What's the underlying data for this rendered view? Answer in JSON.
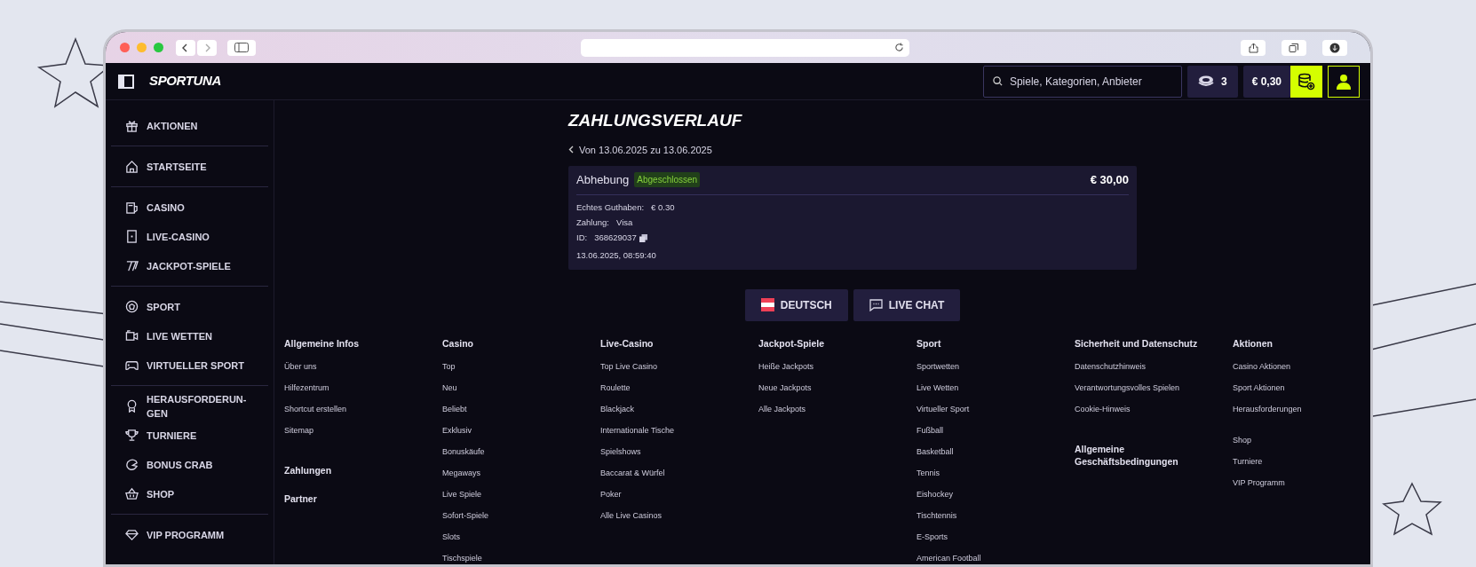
{
  "topbar": {
    "logo": "SPORTUNA",
    "search": {
      "placeholder": "Spiele, Kategorien, Anbieter"
    },
    "coins": "3",
    "balance": "€ 0,30"
  },
  "sidebar": {
    "groups": [
      [
        {
          "label": "AKTIONEN"
        }
      ],
      [
        {
          "label": "STARTSEITE"
        }
      ],
      [
        {
          "label": "CASINO"
        },
        {
          "label": "LIVE-CASINO"
        },
        {
          "label": "JACKPOT-SPIELE"
        }
      ],
      [
        {
          "label": "SPORT"
        },
        {
          "label": "LIVE WETTEN"
        },
        {
          "label": "VIRTUELLER SPORT"
        }
      ],
      [
        {
          "label": "HERAUSFORDERUN-GEN"
        },
        {
          "label": "TURNIERE"
        },
        {
          "label": "BONUS CRAB"
        },
        {
          "label": "SHOP"
        }
      ],
      [
        {
          "label": "VIP PROGRAMM"
        }
      ]
    ]
  },
  "page": {
    "title": "ZAHLUNGSVERLAUF",
    "range": "Von 13.06.2025 zu 13.06.2025",
    "transaction": {
      "type": "Abhebung",
      "status": "Abgeschlossen",
      "amount": "€ 30,00",
      "details": [
        {
          "label": "Echtes Guthaben:",
          "value": "€ 0.30"
        },
        {
          "label": "Zahlung:",
          "value": "Visa"
        },
        {
          "label": "ID:",
          "value": "368629037",
          "copy": true
        }
      ],
      "date": "13.06.2025, 08:59:40"
    },
    "buttons": [
      {
        "kind": "language",
        "label": "DEUTSCH"
      },
      {
        "kind": "chat",
        "label": "LIVE CHAT"
      }
    ]
  },
  "footer": {
    "columns": [
      {
        "heading": "Allgemeine Infos",
        "link_groups": [
          [
            "Über uns",
            "Hilfezentrum",
            "Shortcut erstellen",
            "Sitemap"
          ]
        ],
        "extra_headings": [
          "Zahlungen",
          "Partner"
        ]
      },
      {
        "heading": "Casino",
        "link_groups": [
          [
            "Top",
            "Neu",
            "Beliebt",
            "Exklusiv",
            "Bonuskäufe",
            "Megaways",
            "Live Spiele",
            "Sofort-Spiele",
            "Slots",
            "Tischspiele"
          ]
        ]
      },
      {
        "heading": "Live-Casino",
        "link_groups": [
          [
            "Top Live Casino",
            "Roulette",
            "Blackjack",
            "Internationale Tische",
            "Spielshows",
            "Baccarat & Würfel",
            "Poker",
            "Alle Live Casinos"
          ]
        ]
      },
      {
        "heading": "Jackpot-Spiele",
        "link_groups": [
          [
            "Heiße Jackpots",
            "Neue Jackpots",
            "Alle Jackpots"
          ]
        ]
      },
      {
        "heading": "Sport",
        "link_groups": [
          [
            "Sportwetten",
            "Live Wetten",
            "Virtueller Sport",
            "Fußball",
            "Basketball",
            "Tennis",
            "Eishockey",
            "Tischtennis",
            "E-Sports",
            "American Football"
          ]
        ]
      },
      {
        "heading": "Sicherheit und Datenschutz",
        "link_groups": [
          [
            "Datenschutzhinweis",
            "Verantwortungsvolles Spielen",
            "Cookie-Hinweis"
          ]
        ],
        "extra_headings": [
          "Allgemeine Geschäftsbedingungen"
        ]
      },
      {
        "heading": "Aktionen",
        "link_groups": [
          [
            "Casino Aktionen",
            "Sport Aktionen",
            "Herausforderungen"
          ],
          [
            "Shop",
            "Turniere",
            "VIP Programm"
          ]
        ]
      }
    ]
  }
}
